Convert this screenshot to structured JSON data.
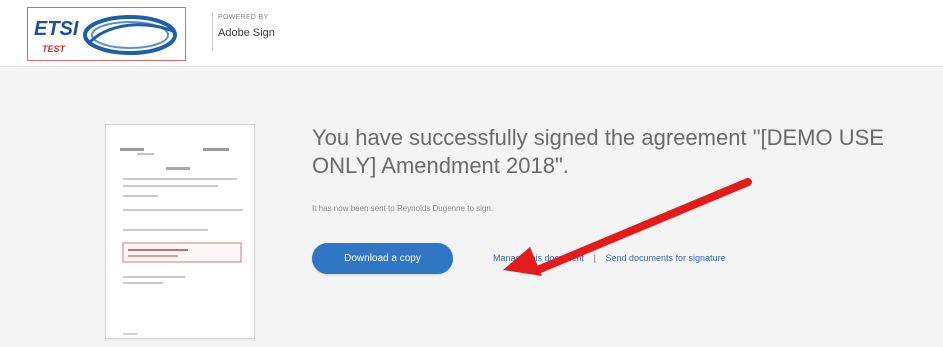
{
  "header": {
    "logo_text": "ETSI",
    "logo_sub": "TEST",
    "powered_label": "POWERED BY",
    "product_name": "Adobe Sign"
  },
  "main": {
    "headline": "You have successfully signed the agreement \"[DEMO USE ONLY] Amendment 2018\".",
    "subtext": "It has now been sent to Reynolds Dugenne to sign.",
    "download_button": "Download a copy",
    "manage_link": "Manage this document",
    "send_link": "Send documents for signature"
  },
  "colors": {
    "button": "#2f77c4",
    "annotation_arrow": "#e41b1b",
    "background": "#f4f4f4"
  },
  "icons": {
    "logo": "etsi-logo",
    "thumbnail": "document-thumbnail",
    "arrow": "red-pointer-arrow"
  }
}
